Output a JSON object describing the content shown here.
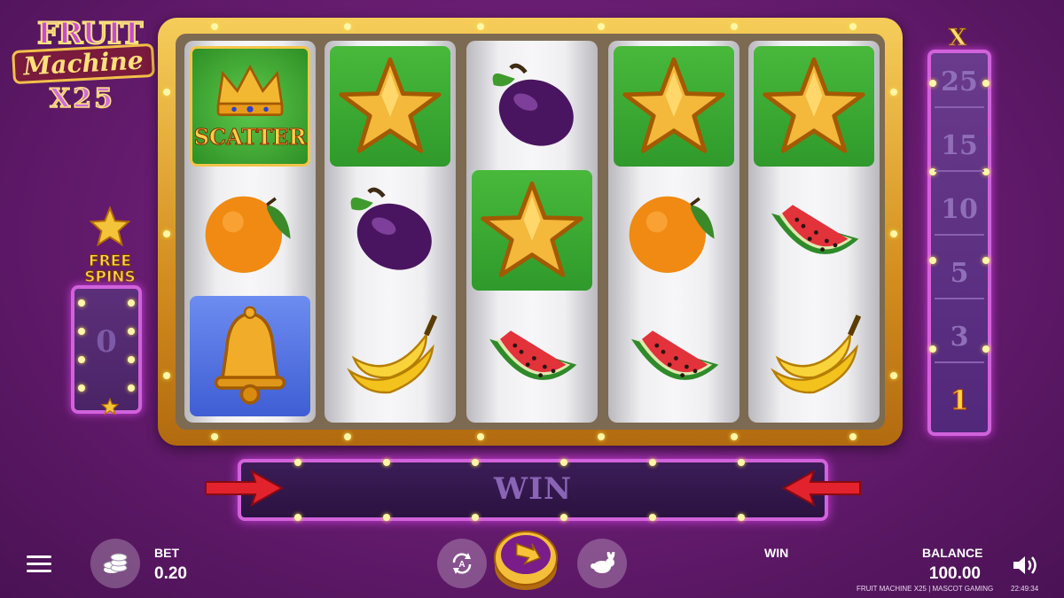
{
  "logo": {
    "line1": "FRUIT",
    "line2": "Machine",
    "line3": "X25"
  },
  "free_spins": {
    "label_line1": "FREE",
    "label_line2": "SPINS",
    "count": "0"
  },
  "reels": [
    {
      "symbols": [
        "scatter-crown",
        "orange",
        "bell"
      ],
      "scatter_text": "SCATTER"
    },
    {
      "symbols": [
        "star",
        "plum",
        "banana"
      ]
    },
    {
      "symbols": [
        "plum",
        "star",
        "watermelon"
      ]
    },
    {
      "symbols": [
        "star",
        "orange",
        "watermelon"
      ]
    },
    {
      "symbols": [
        "star",
        "watermelon",
        "banana"
      ]
    }
  ],
  "multiplier": {
    "header": "X",
    "levels": [
      "25",
      "15",
      "10",
      "5",
      "3",
      "1"
    ],
    "active": "1"
  },
  "win_bar": {
    "label": "WIN"
  },
  "bottom": {
    "bet_label": "BET",
    "bet_value": "0.20",
    "win_label": "WIN",
    "balance_label": "BALANCE",
    "balance_value": "100.00",
    "footer": "FRUIT MACHINE X25 | MASCOT GAMING",
    "clock": "22:49:34"
  },
  "colors": {
    "frame_gold": "#d48e1f",
    "panel_purple": "#d262dc",
    "tile_green": "#3aa52f",
    "tile_blue": "#4f6fe0",
    "background": "#6a1d73"
  }
}
